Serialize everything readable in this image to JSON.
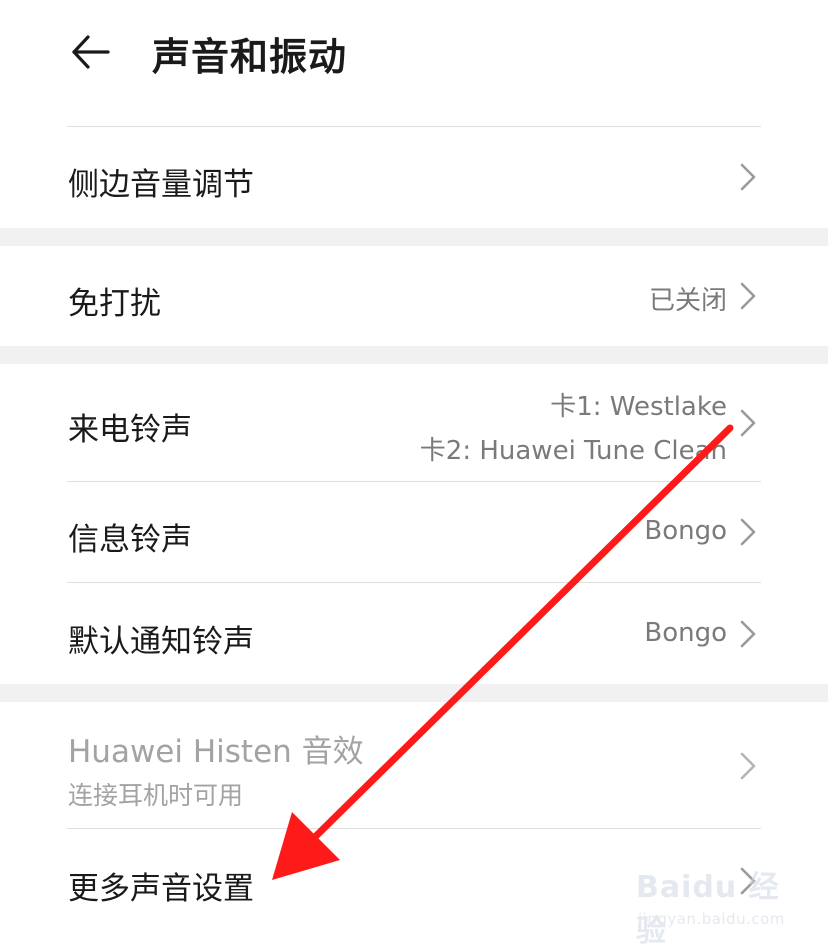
{
  "header": {
    "title": "声音和振动",
    "back_icon": "arrow-left-icon"
  },
  "rows": {
    "side_volume": {
      "label": "侧边音量调节"
    },
    "dnd": {
      "label": "免打扰",
      "value": "已关闭"
    },
    "ringtone": {
      "label": "来电铃声",
      "value_line1": "卡1: Westlake",
      "value_line2": "卡2: Huawei Tune Clean"
    },
    "message_tone": {
      "label": "信息铃声",
      "value": "Bongo"
    },
    "notification_tone": {
      "label": "默认通知铃声",
      "value": "Bongo"
    },
    "histen": {
      "label": "Huawei Histen 音效",
      "sublabel": "连接耳机时可用"
    },
    "more_sound": {
      "label": "更多声音设置"
    }
  },
  "watermark": {
    "logo": "Baidu 经验",
    "url": "jingyan.baidu.com"
  },
  "colors": {
    "annotation_arrow": "#ff1a1a",
    "separator": "#dedede",
    "gap": "#f1f1f1",
    "secondary_text": "#7a7a7a",
    "disabled_text": "#a3a3a3"
  }
}
